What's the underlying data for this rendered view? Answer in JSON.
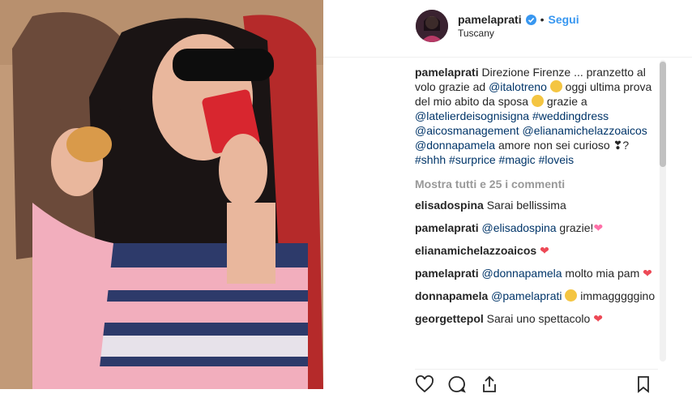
{
  "post": {
    "username": "pamelaprati",
    "location": "Tuscany",
    "follow_label": "Segui",
    "separator": "•"
  },
  "caption": {
    "author": "pamelaprati",
    "t1": " Direzione Firenze ... pranzetto al volo grazie ad ",
    "m1": "@italotreno",
    "t2": " oggi ultima prova del mio abito da sposa ",
    "t3": " grazie a ",
    "m2": "@latelierdeisognisigna",
    "h1": "#weddingdress",
    "m3": "@aicosmanagement",
    "m4": "@elianamichelazzoaicos",
    "m5": "@donnapamela",
    "t4": " amore non sei curioso ",
    "t5": "? ",
    "h2": "#shhh",
    "h3": "#surprice",
    "h4": "#magic",
    "h5": "#loveis"
  },
  "view_all": "Mostra tutti e 25 i commenti",
  "comments": [
    {
      "user": "elisadospina",
      "text": " Sarai bellissima"
    },
    {
      "user": "pamelaprati",
      "mention": "@elisadospina",
      "text": " grazie!"
    },
    {
      "user": "elianamichelazzoaicos",
      "text": " "
    },
    {
      "user": "pamelaprati",
      "mention": "@donnapamela",
      "text": " molto mia pam "
    },
    {
      "user": "donnapamela",
      "mention": "@pamelaprati",
      "text": " immagggggino"
    },
    {
      "user": "georgettepol",
      "text": " Sarai uno spettacolo "
    }
  ],
  "icons": [
    "verified-badge-icon",
    "like-heart-icon",
    "comment-icon",
    "share-icon",
    "bookmark-icon"
  ],
  "colors": {
    "link": "#003569",
    "follow": "#3897f0",
    "heart": "#ed4956",
    "muted": "#999999"
  }
}
